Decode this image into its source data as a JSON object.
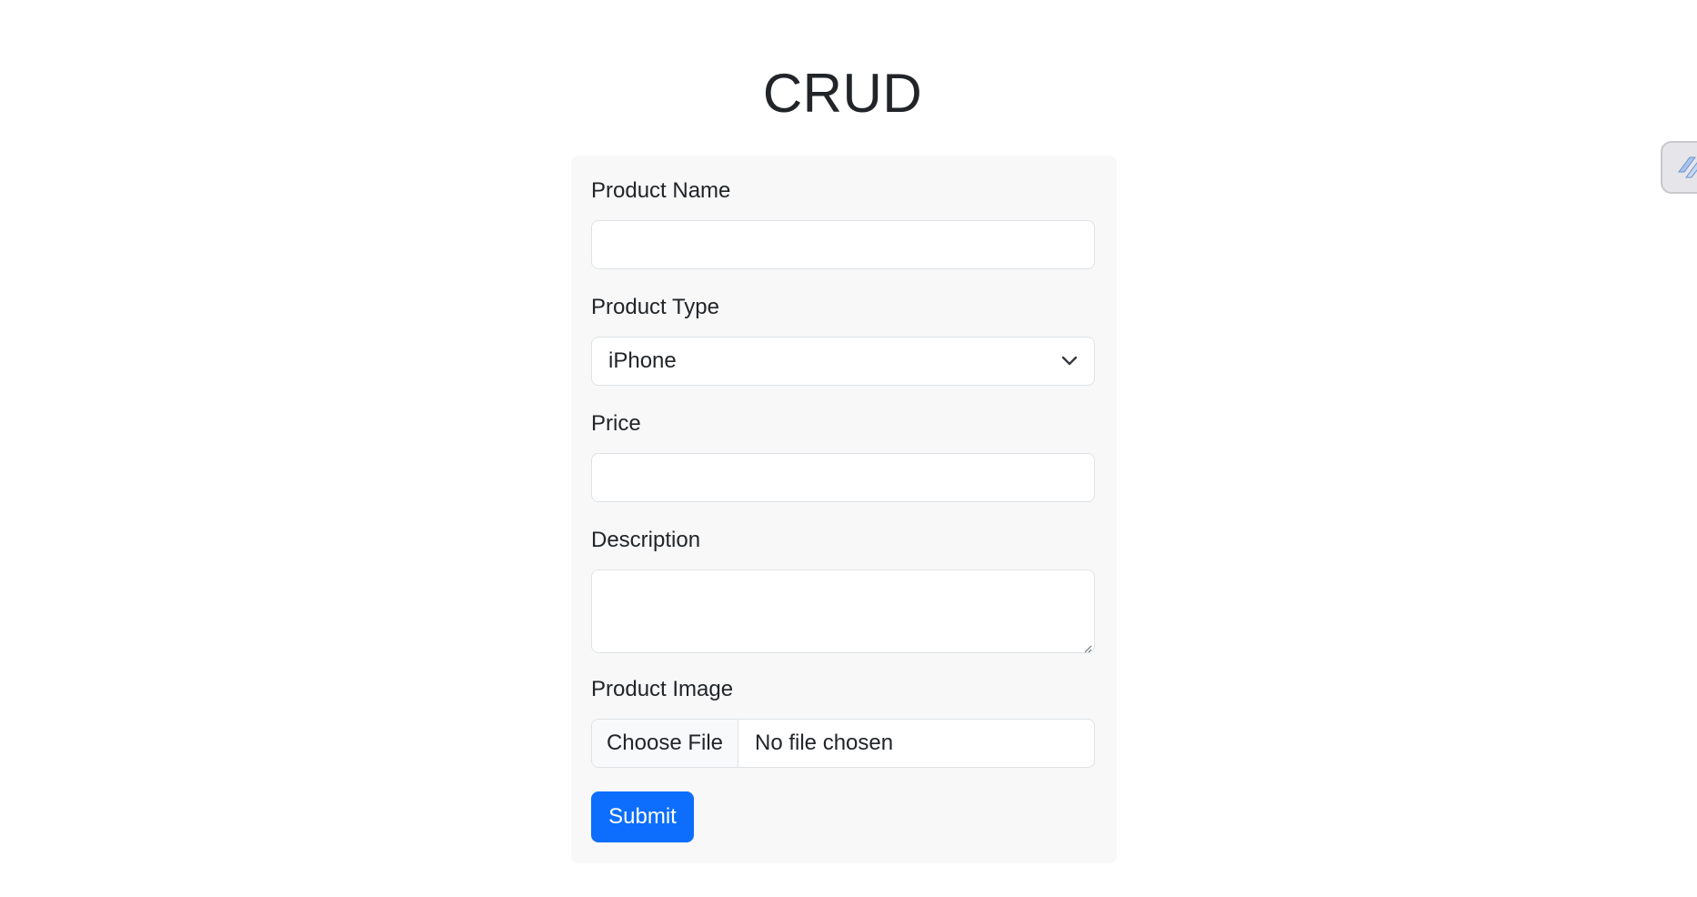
{
  "page": {
    "title": "CRUD"
  },
  "form": {
    "product_name": {
      "label": "Product Name",
      "value": ""
    },
    "product_type": {
      "label": "Product Type",
      "selected": "iPhone"
    },
    "price": {
      "label": "Price",
      "value": ""
    },
    "description": {
      "label": "Description",
      "value": ""
    },
    "product_image": {
      "label": "Product Image",
      "button_label": "Choose File",
      "status": "No file chosen"
    },
    "submit_label": "Submit"
  },
  "icons": {
    "select_arrow": "chevron-down-icon",
    "side_widget": "extension-icon"
  },
  "colors": {
    "primary": "#0d6efd",
    "card_background": "#f8f8f8",
    "border": "#dee2e6",
    "text": "#212529"
  }
}
